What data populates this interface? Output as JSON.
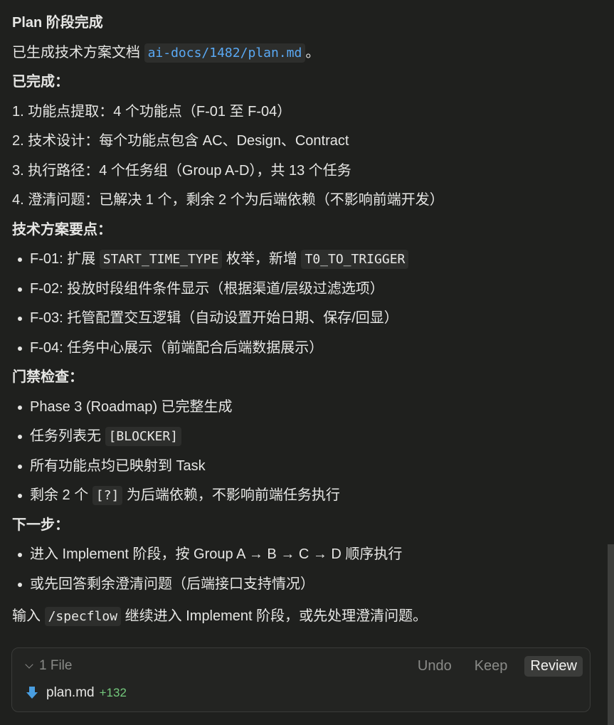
{
  "message": {
    "title": "Plan 阶段完成",
    "intro_prefix": "已生成技术方案文档 ",
    "intro_file": "ai-docs/1482/plan.md",
    "intro_suffix": "。",
    "completed_heading": "已完成：",
    "completed_items": [
      "1. 功能点提取：4 个功能点（F-01 至 F-04）",
      "2. 技术设计：每个功能点包含 AC、Design、Contract",
      "3. 执行路径：4 个任务组（Group A-D），共 13 个任务",
      "4. 澄清问题：已解决 1 个，剩余 2 个为后端依赖（不影响前端开发）"
    ],
    "tech_heading": "技术方案要点：",
    "tech_items": {
      "f01_prefix": "F-01: 扩展 ",
      "f01_code1": "START_TIME_TYPE",
      "f01_mid": " 枚举，新增 ",
      "f01_code2": "T0_TO_TRIGGER",
      "f02": "F-02: 投放时段组件条件显示（根据渠道/层级过滤选项）",
      "f03": "F-03: 托管配置交互逻辑（自动设置开始日期、保存/回显）",
      "f04": "F-04: 任务中心展示（前端配合后端数据展示）"
    },
    "gate_heading": "门禁检查：",
    "gate_items": {
      "g1": "Phase 3 (Roadmap) 已完整生成",
      "g2_prefix": "任务列表无 ",
      "g2_code": "[BLOCKER]",
      "g3": "所有功能点均已映射到 Task",
      "g4_prefix": "剩余 2 个 ",
      "g4_code": "[?]",
      "g4_suffix": " 为后端依赖，不影响前端任务执行"
    },
    "next_heading": "下一步：",
    "next_items": [
      "进入 Implement 阶段，按 Group A → B → C → D 顺序执行",
      "或先回答剩余澄清问题（后端接口支持情况）"
    ],
    "final_prefix": "输入 ",
    "final_code": "/specflow",
    "final_suffix": " 继续进入 Implement 阶段，或先处理澄清问题。"
  },
  "file_panel": {
    "count_label": "1 File",
    "undo_label": "Undo",
    "keep_label": "Keep",
    "review_label": "Review",
    "file_name": "plan.md",
    "additions": "+132",
    "file_icon": "download-arrow-icon",
    "icon_color": "#4a9ee0"
  }
}
